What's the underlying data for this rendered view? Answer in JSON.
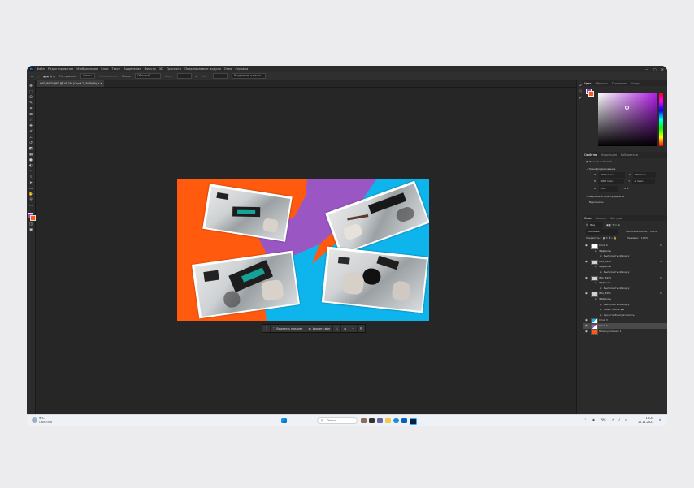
{
  "menubar": {
    "items": [
      "Файл",
      "Редактирование",
      "Изображение",
      "Слои",
      "Текст",
      "Выделение",
      "Фильтр",
      "3D",
      "Просмотр",
      "Подключаемые модули",
      "Окно",
      "Справка"
    ]
  },
  "optbar": {
    "feather_label": "Растушевка:",
    "feather_value": "0 пикс.",
    "smoothing": "Сглаживание",
    "style_label": "Стиль:",
    "style_value": "Обычный",
    "width_label": "Шир.:",
    "height_label": "Выс.:",
    "select_mask_button": "Выделение и маска..."
  },
  "document": {
    "tab_title": "IMG_8975.JPG @ 16,7% (Слой 2, RGB/8*) *"
  },
  "contextbar": {
    "select_subject": "Выделить предмет",
    "remove_bg": "Удалить фон"
  },
  "statusbar": {
    "zoom": "16,67%",
    "size": "3000 пикс. x 1688 пикс. (300 ppi)"
  },
  "color_panel": {
    "tabs": [
      "Цвет",
      "Образцы",
      "Градиенты",
      "Узоры"
    ],
    "foreground": "#9c45b8",
    "background": "#ff5a0e",
    "hue_accent": "#b01ee6"
  },
  "properties_panel": {
    "tabs": [
      "Свойства",
      "Коррекция",
      "Библиотеки"
    ],
    "pixel_layer": "Пиксельный слой",
    "transform_label": "Трансформирование",
    "w_value": "3000 пикс.",
    "x_value": "460 пикс.",
    "h_value": "1688 пикс.",
    "y_value": "-1 пикс.",
    "angle_value": "0,00°",
    "align_label": "Выровнять и распределить",
    "align_sub": "Выровнять:"
  },
  "layers_panel": {
    "tabs": [
      "Слои",
      "Каналы",
      "Контуры"
    ],
    "search_label": "Вид",
    "blend_mode": "Обычные",
    "opacity_label": "Непрозрачность:",
    "opacity_value": "100%",
    "lock_label": "Закрепить:",
    "fill_label": "Заливка:",
    "fill_value": "100%",
    "layers": [
      {
        "name": "Слой 4",
        "fx": "fx",
        "kind": "layer"
      },
      {
        "name": "Эффекты",
        "fx": "",
        "kind": "effects"
      },
      {
        "name": "Выполнить обводку",
        "fx": "",
        "kind": "effect"
      },
      {
        "name": "IMG_8999",
        "fx": "fx",
        "kind": "layer"
      },
      {
        "name": "Эффекты",
        "fx": "",
        "kind": "effects"
      },
      {
        "name": "Выполнить обводку",
        "fx": "",
        "kind": "effect"
      },
      {
        "name": "IMG_8993",
        "fx": "fx",
        "kind": "layer"
      },
      {
        "name": "Эффекты",
        "fx": "",
        "kind": "effects"
      },
      {
        "name": "Выполнить обводку",
        "fx": "",
        "kind": "effect"
      },
      {
        "name": "IMG_8981",
        "fx": "fx",
        "kind": "layer"
      },
      {
        "name": "Эффекты",
        "fx": "",
        "kind": "effects"
      },
      {
        "name": "Выполнить обводку",
        "fx": "",
        "kind": "effect"
      },
      {
        "name": "Смарт-фильтры",
        "fx": "",
        "kind": "effect"
      },
      {
        "name": "Яркость/Контрастность",
        "fx": "",
        "kind": "effect"
      },
      {
        "name": "Слой 3",
        "fx": "",
        "kind": "layer"
      },
      {
        "name": "Слой 2",
        "fx": "",
        "kind": "layer",
        "selected": true
      },
      {
        "name": "Прямоугольник 1",
        "fx": "",
        "kind": "layer"
      }
    ]
  },
  "taskbar": {
    "weather_temp": "9°C",
    "weather_text": "Облачно",
    "search_placeholder": "Поиск",
    "lang": "РУС",
    "time": "16:24",
    "date": "12.11.2023"
  }
}
